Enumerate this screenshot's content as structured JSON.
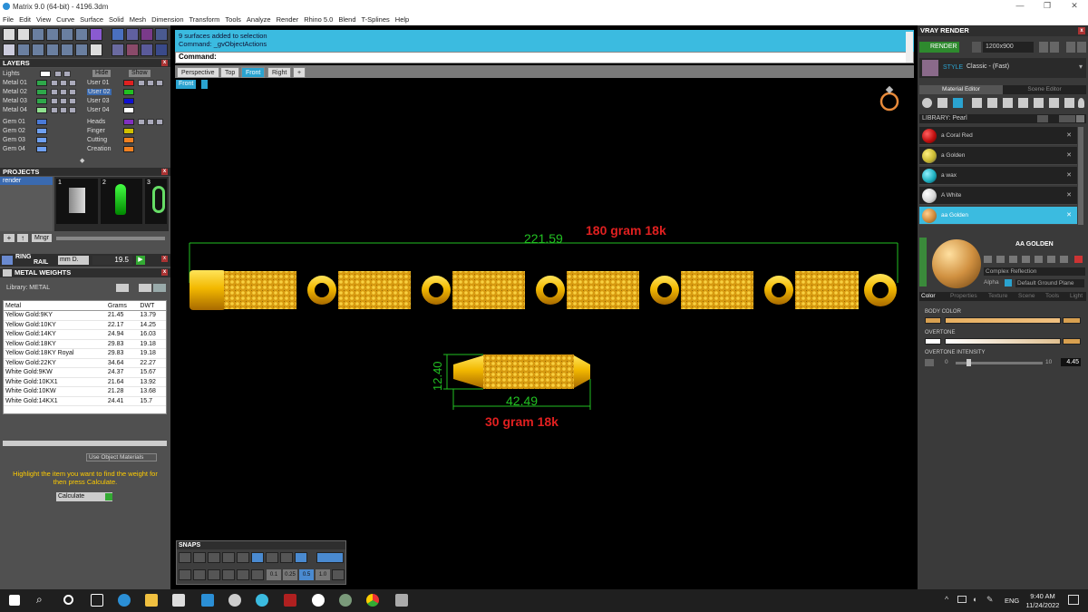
{
  "window": {
    "title": "Matrix 9.0 (64-bit) - 4196.3dm",
    "controls": [
      "—",
      "❐",
      "✕"
    ]
  },
  "menu": [
    "File",
    "Edit",
    "View",
    "Curve",
    "Surface",
    "Solid",
    "Mesh",
    "Dimension",
    "Transform",
    "Tools",
    "Analyze",
    "Render",
    "Rhino 5.0",
    "Blend",
    "T-Splines",
    "Help"
  ],
  "layers": {
    "header": "LAYERS",
    "lights_label": "Lights",
    "hide_label": "Hide",
    "show_label": "Show",
    "left": [
      {
        "name": "Metal 01",
        "color": "#2ea84a"
      },
      {
        "name": "Metal 02",
        "color": "#2ea84a"
      },
      {
        "name": "Metal 03",
        "color": "#2ea84a"
      },
      {
        "name": "Metal 04",
        "color": "#8fe08f"
      },
      {
        "name": "Gem 01",
        "color": "#4a7ad8"
      },
      {
        "name": "Gem 02",
        "color": "#6fa0f0"
      },
      {
        "name": "Gem 03",
        "color": "#6fa0f0"
      },
      {
        "name": "Gem 04",
        "color": "#6fa0f0"
      }
    ],
    "right": [
      {
        "name": "User 01",
        "color": "#e02020"
      },
      {
        "name": "User 02",
        "color": "#20c020"
      },
      {
        "name": "User 03",
        "color": "#1010d0"
      },
      {
        "name": "User 04",
        "color": "#ffffff"
      },
      {
        "name": "Heads",
        "color": "#8030c0"
      },
      {
        "name": "Finger",
        "color": "#d0c000"
      },
      {
        "name": "Cutting",
        "color": "#f08020"
      },
      {
        "name": "Creation",
        "color": "#f08020"
      }
    ]
  },
  "projects": {
    "header": "PROJECTS",
    "items": [
      "render"
    ],
    "slots": [
      "1",
      "2",
      "3"
    ],
    "buttons": [
      "+",
      "↑",
      "Mngr"
    ]
  },
  "ring_rail": {
    "label_top": "RING",
    "label_bottom": "RAIL",
    "unit": "mm D.",
    "value": "19.5"
  },
  "metal_weights": {
    "header": "METAL WEIGHTS",
    "library": "Library: METAL",
    "columns": [
      "Metal",
      "Grams",
      "DWT"
    ],
    "rows": [
      [
        "Yellow Gold:9KY",
        "21.45",
        "13.79"
      ],
      [
        "Yellow Gold:10KY",
        "22.17",
        "14.25"
      ],
      [
        "Yellow Gold:14KY",
        "24.94",
        "16.03"
      ],
      [
        "Yellow Gold:18KY",
        "29.83",
        "19.18"
      ],
      [
        "Yellow Gold:18KY Royal",
        "29.83",
        "19.18"
      ],
      [
        "Yellow Gold:22KY",
        "34.64",
        "22.27"
      ],
      [
        "White Gold:9KW",
        "24.37",
        "15.67"
      ],
      [
        "White Gold:10KX1",
        "21.64",
        "13.92"
      ],
      [
        "White Gold:10KW",
        "21.28",
        "13.68"
      ],
      [
        "White Gold:14KX1",
        "24.41",
        "15.7"
      ]
    ],
    "use_object_materials": "Use Object Materials",
    "hint": "Highlight the item you want to find the weight for then press Calculate.",
    "calculate": "Calculate"
  },
  "command": {
    "history": [
      "9 surfaces added to selection",
      "Command: _gvObjectActions"
    ],
    "prompt": "Command:",
    "value": ""
  },
  "view_tabs": [
    "Perspective",
    "Top",
    "Front",
    "Right",
    "+"
  ],
  "active_tab": "Front",
  "viewport_label": "Front",
  "annotations": {
    "top_width": "221.59",
    "top_weight": "180 gram 18k",
    "bottom_height": "12.40",
    "bottom_width": "42.49",
    "bottom_weight": "30 gram 18k"
  },
  "snaps": {
    "header": "SNAPS",
    "values": [
      "0.1",
      "0.25",
      "0.5",
      "1.0"
    ]
  },
  "vray": {
    "header": "VRAY RENDER",
    "render_button": "RENDER",
    "resolution": "1200x900",
    "style_label": "STYLE",
    "style_value": "Classic - (Fast)",
    "tabs": [
      "Material Editor",
      "Scene Editor"
    ],
    "library": "LIBRARY: Pearl",
    "materials": [
      {
        "name": "a Coral Red",
        "color": "#c01010"
      },
      {
        "name": "a Golden",
        "color": "#c8b830"
      },
      {
        "name": "a wax",
        "color": "#20b0c0"
      },
      {
        "name": "A White",
        "color": "#d8d8d8"
      },
      {
        "name": "aa Golden",
        "color": "#d08a3a"
      }
    ],
    "selected_material": "AA  GOLDEN",
    "reflection": "Complex Reflection",
    "alpha": "Alpha",
    "ground": "Default Ground Plane",
    "sub_tabs": [
      "Color",
      "Properties",
      "Texture",
      "Scene",
      "Tools",
      "Light"
    ],
    "body_color": "BODY COLOR",
    "overtone": "OVERTONE",
    "overtone_intensity": "OVERTONE INTENSITY",
    "intensity_min": "0",
    "intensity_max": "10",
    "intensity_value": "4.45"
  },
  "taskbar": {
    "lang": "ENG",
    "time": "9:40 AM",
    "date": "11/24/2022"
  }
}
